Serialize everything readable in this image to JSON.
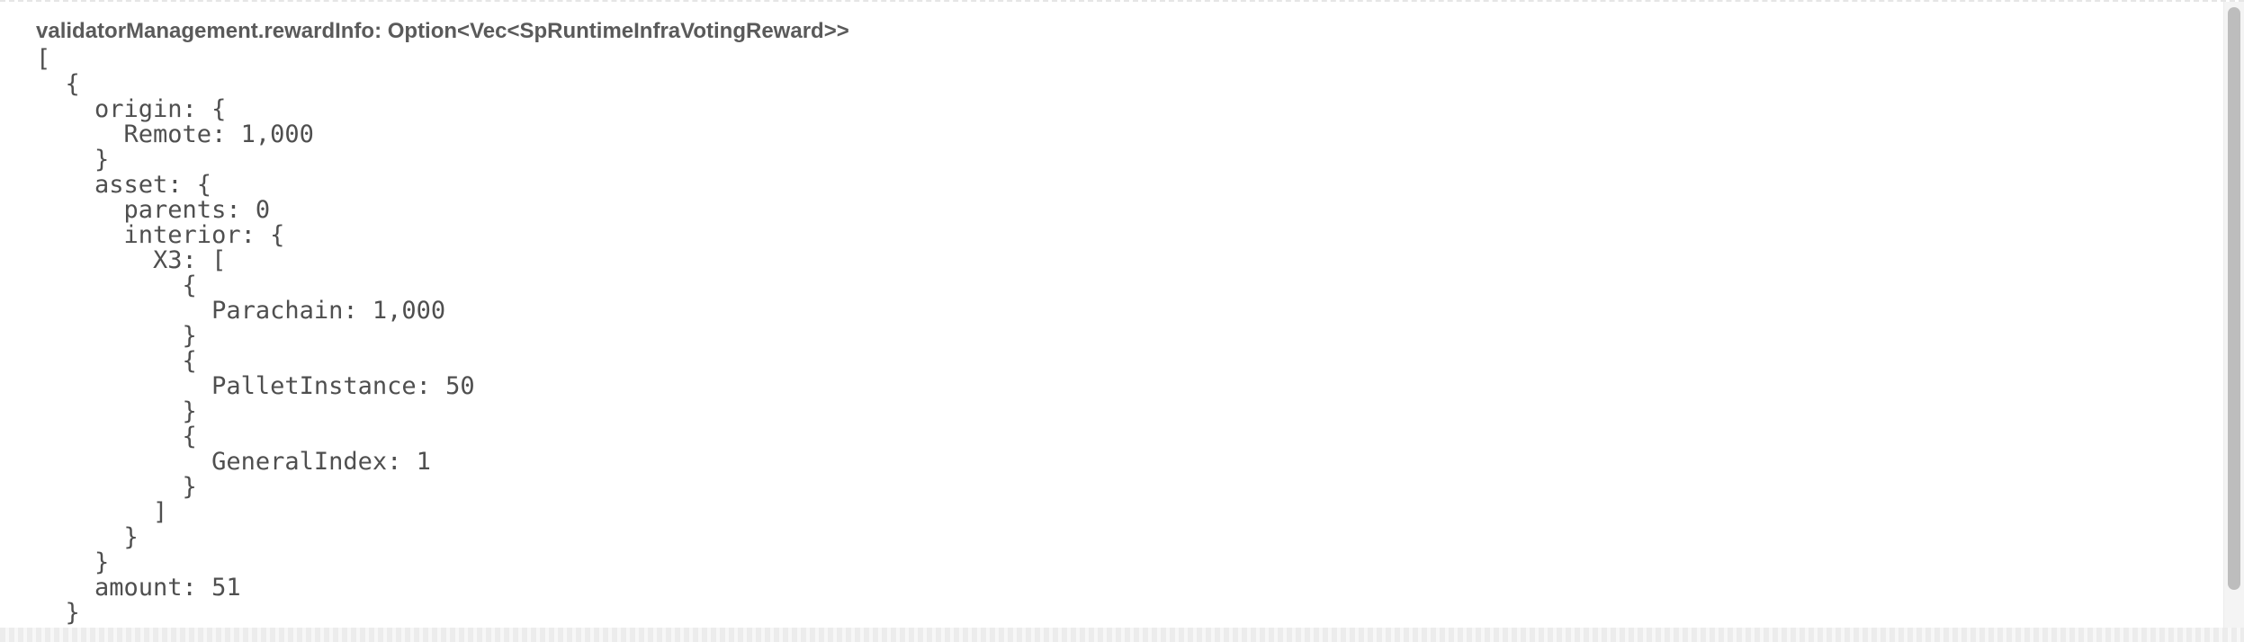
{
  "header": {
    "title": "validatorManagement.rewardInfo: Option<Vec<SpRuntimeInfraVotingReward>>"
  },
  "code": {
    "lines": [
      "[",
      "  {",
      "    origin: {",
      "      Remote: 1,000",
      "    }",
      "    asset: {",
      "      parents: 0",
      "      interior: {",
      "        X3: [",
      "          {",
      "            Parachain: 1,000",
      "          }",
      "          {",
      "            PalletInstance: 50",
      "          }",
      "          {",
      "            GeneralIndex: 1",
      "          }",
      "        ]",
      "      }",
      "    }",
      "    amount: 51",
      "  }",
      "]"
    ]
  }
}
